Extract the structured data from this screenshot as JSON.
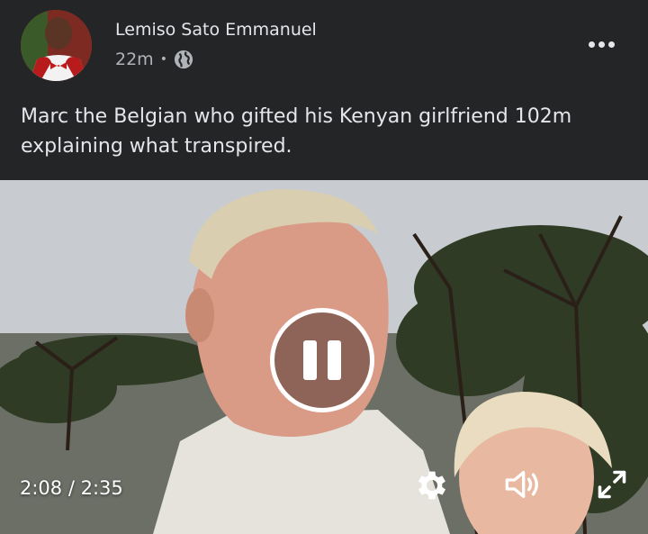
{
  "post": {
    "author": "Lemiso Sato Emmanuel",
    "time": "22m",
    "separator": "•",
    "privacy_icon": "globe-icon",
    "caption_line1": "Marc the Belgian who gifted his Kenyan girlfriend 102m",
    "caption_line2": "explaining what transpired.",
    "more_icon": "more-horizontal-icon"
  },
  "video": {
    "state": "playing",
    "time_display": "2:08 / 2:35",
    "controls": [
      "pause-icon",
      "settings-icon",
      "volume-icon",
      "fullscreen-icon"
    ]
  },
  "colors": {
    "background": "#242526",
    "primary_text": "#e4e6eb",
    "secondary_text": "#b0b3b8"
  }
}
